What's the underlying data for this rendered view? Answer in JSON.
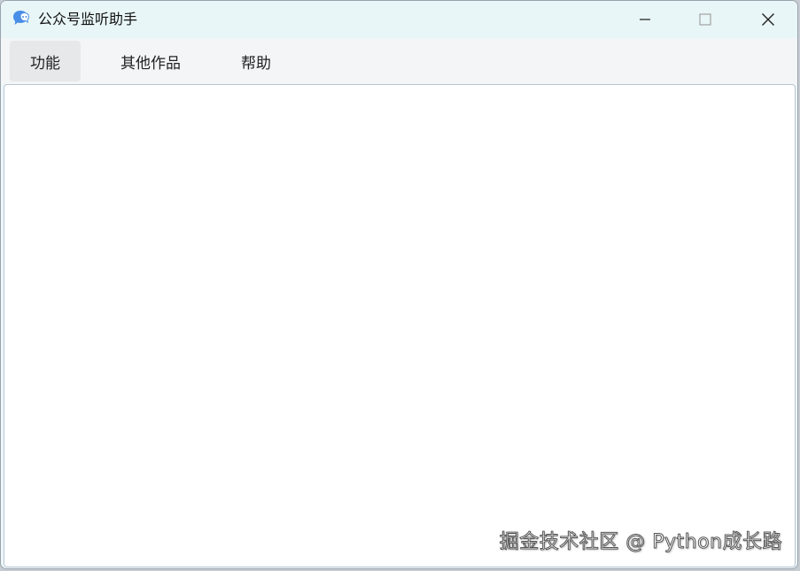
{
  "window": {
    "title": "公众号监听助手",
    "icon": "chat-bubble-icon"
  },
  "window_controls": {
    "minimize_icon": "minimize-icon",
    "maximize_icon": "maximize-icon",
    "close_icon": "close-icon"
  },
  "menu": {
    "items": [
      {
        "label": "功能",
        "active": true
      },
      {
        "label": "其他作品",
        "active": false
      },
      {
        "label": "帮助",
        "active": false
      }
    ]
  },
  "watermark": {
    "text": "掘金技术社区 @ Python成长路"
  },
  "colors": {
    "titlebar_bg": "#e9f6f7",
    "menubar_bg": "#f3f5f7",
    "menu_active_bg": "#e6e8ea",
    "content_bg": "#ffffff",
    "icon_blue": "#4a8fe7"
  }
}
